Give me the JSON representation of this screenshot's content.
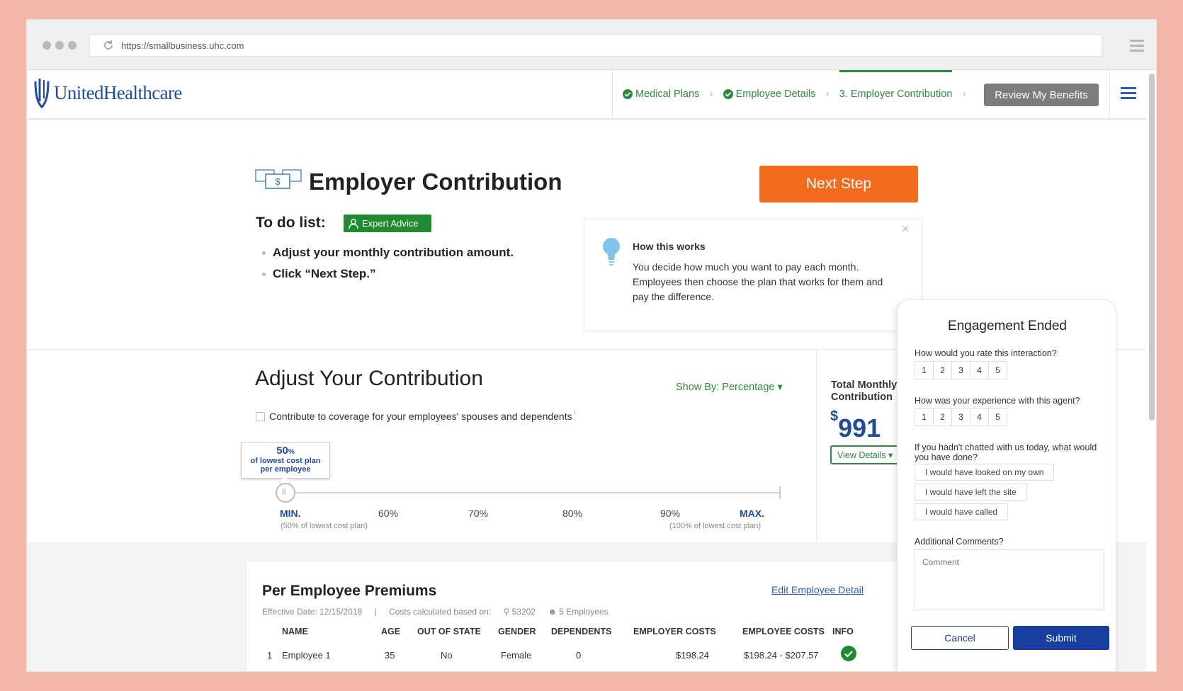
{
  "browser": {
    "url": "https://smallbusiness.uhc.com"
  },
  "header": {
    "logo_text": "UnitedHealthcare",
    "steps": [
      {
        "label": "Medical Plans",
        "status": "complete"
      },
      {
        "label": "Employee Details",
        "status": "complete"
      },
      {
        "label": "3. Employer Contribution",
        "status": "active"
      }
    ],
    "review_button": "Review My Benefits"
  },
  "intro": {
    "title": "Employer Contribution",
    "next_button": "Next Step",
    "todo_label": "To do list:",
    "expert_badge": "Expert Advice",
    "todo_items": [
      "Adjust your monthly contribution amount.",
      "Click “Next Step.”"
    ],
    "how": {
      "title": "How this works",
      "text": "You decide how much you want to pay each month. Employees then choose the plan that works for them and pay the difference.",
      "close": "×"
    }
  },
  "adjust": {
    "title": "Adjust Your Contribution",
    "show_by": "Show By: Percentage ▾",
    "checkbox_label": "Contribute to coverage for your employees' spouses and dependents",
    "info": "i",
    "slider": {
      "value_pct": 50,
      "tooltip_value": "50",
      "tooltip_unit": "%",
      "tooltip_line1": "of lowest cost plan",
      "tooltip_line2": "per employee",
      "ticks": [
        "MIN.",
        "60%",
        "70%",
        "80%",
        "90%",
        "MAX."
      ],
      "min_sub": "(50% of lowest cost plan)",
      "max_sub": "(100% of lowest cost plan)"
    },
    "total_label_1": "Total Monthly",
    "total_label_2": "Contribution",
    "total_currency": "$",
    "total_amount": "991",
    "view_details": "View Details ▾"
  },
  "premiums": {
    "title": "Per Employee Premiums",
    "edit_link": "Edit Employee Detail",
    "effective_date": "Effective Date: 12/15/2018",
    "separator": "|",
    "costs_based_on": "Costs calculated based on:",
    "zip": "⚲ 53202",
    "employees": "☻ 5 Employees",
    "columns": [
      "NAME",
      "AGE",
      "OUT OF STATE",
      "GENDER",
      "DEPENDENTS",
      "EMPLOYER COSTS",
      "EMPLOYEE COSTS",
      "INFO"
    ],
    "rows": [
      {
        "index": "1",
        "name": "Employee 1",
        "age": "35",
        "out_of_state": "No",
        "gender": "Female",
        "dependents": "0",
        "employer_costs": "$198.24",
        "employee_costs": "$198.24 - $207.57",
        "info_icon": "check-circle-icon"
      }
    ]
  },
  "engagement": {
    "title": "Engagement Ended",
    "q1": "How would you rate this interaction?",
    "q2": "How was your experience with this agent?",
    "ratings": [
      "1",
      "2",
      "3",
      "4",
      "5"
    ],
    "q3": "If you hadn't chatted with us today, what would you have done?",
    "options": [
      "I would have looked on my own",
      "I would have left the site",
      "I would have called"
    ],
    "comments_label": "Additional Comments?",
    "comment_placeholder": "Comment",
    "cancel": "Cancel",
    "submit": "Submit"
  },
  "colors": {
    "brand_blue": "#1f4d99",
    "green": "#2b8a3e",
    "orange": "#f26a1e",
    "background": "#f2b6ab"
  }
}
